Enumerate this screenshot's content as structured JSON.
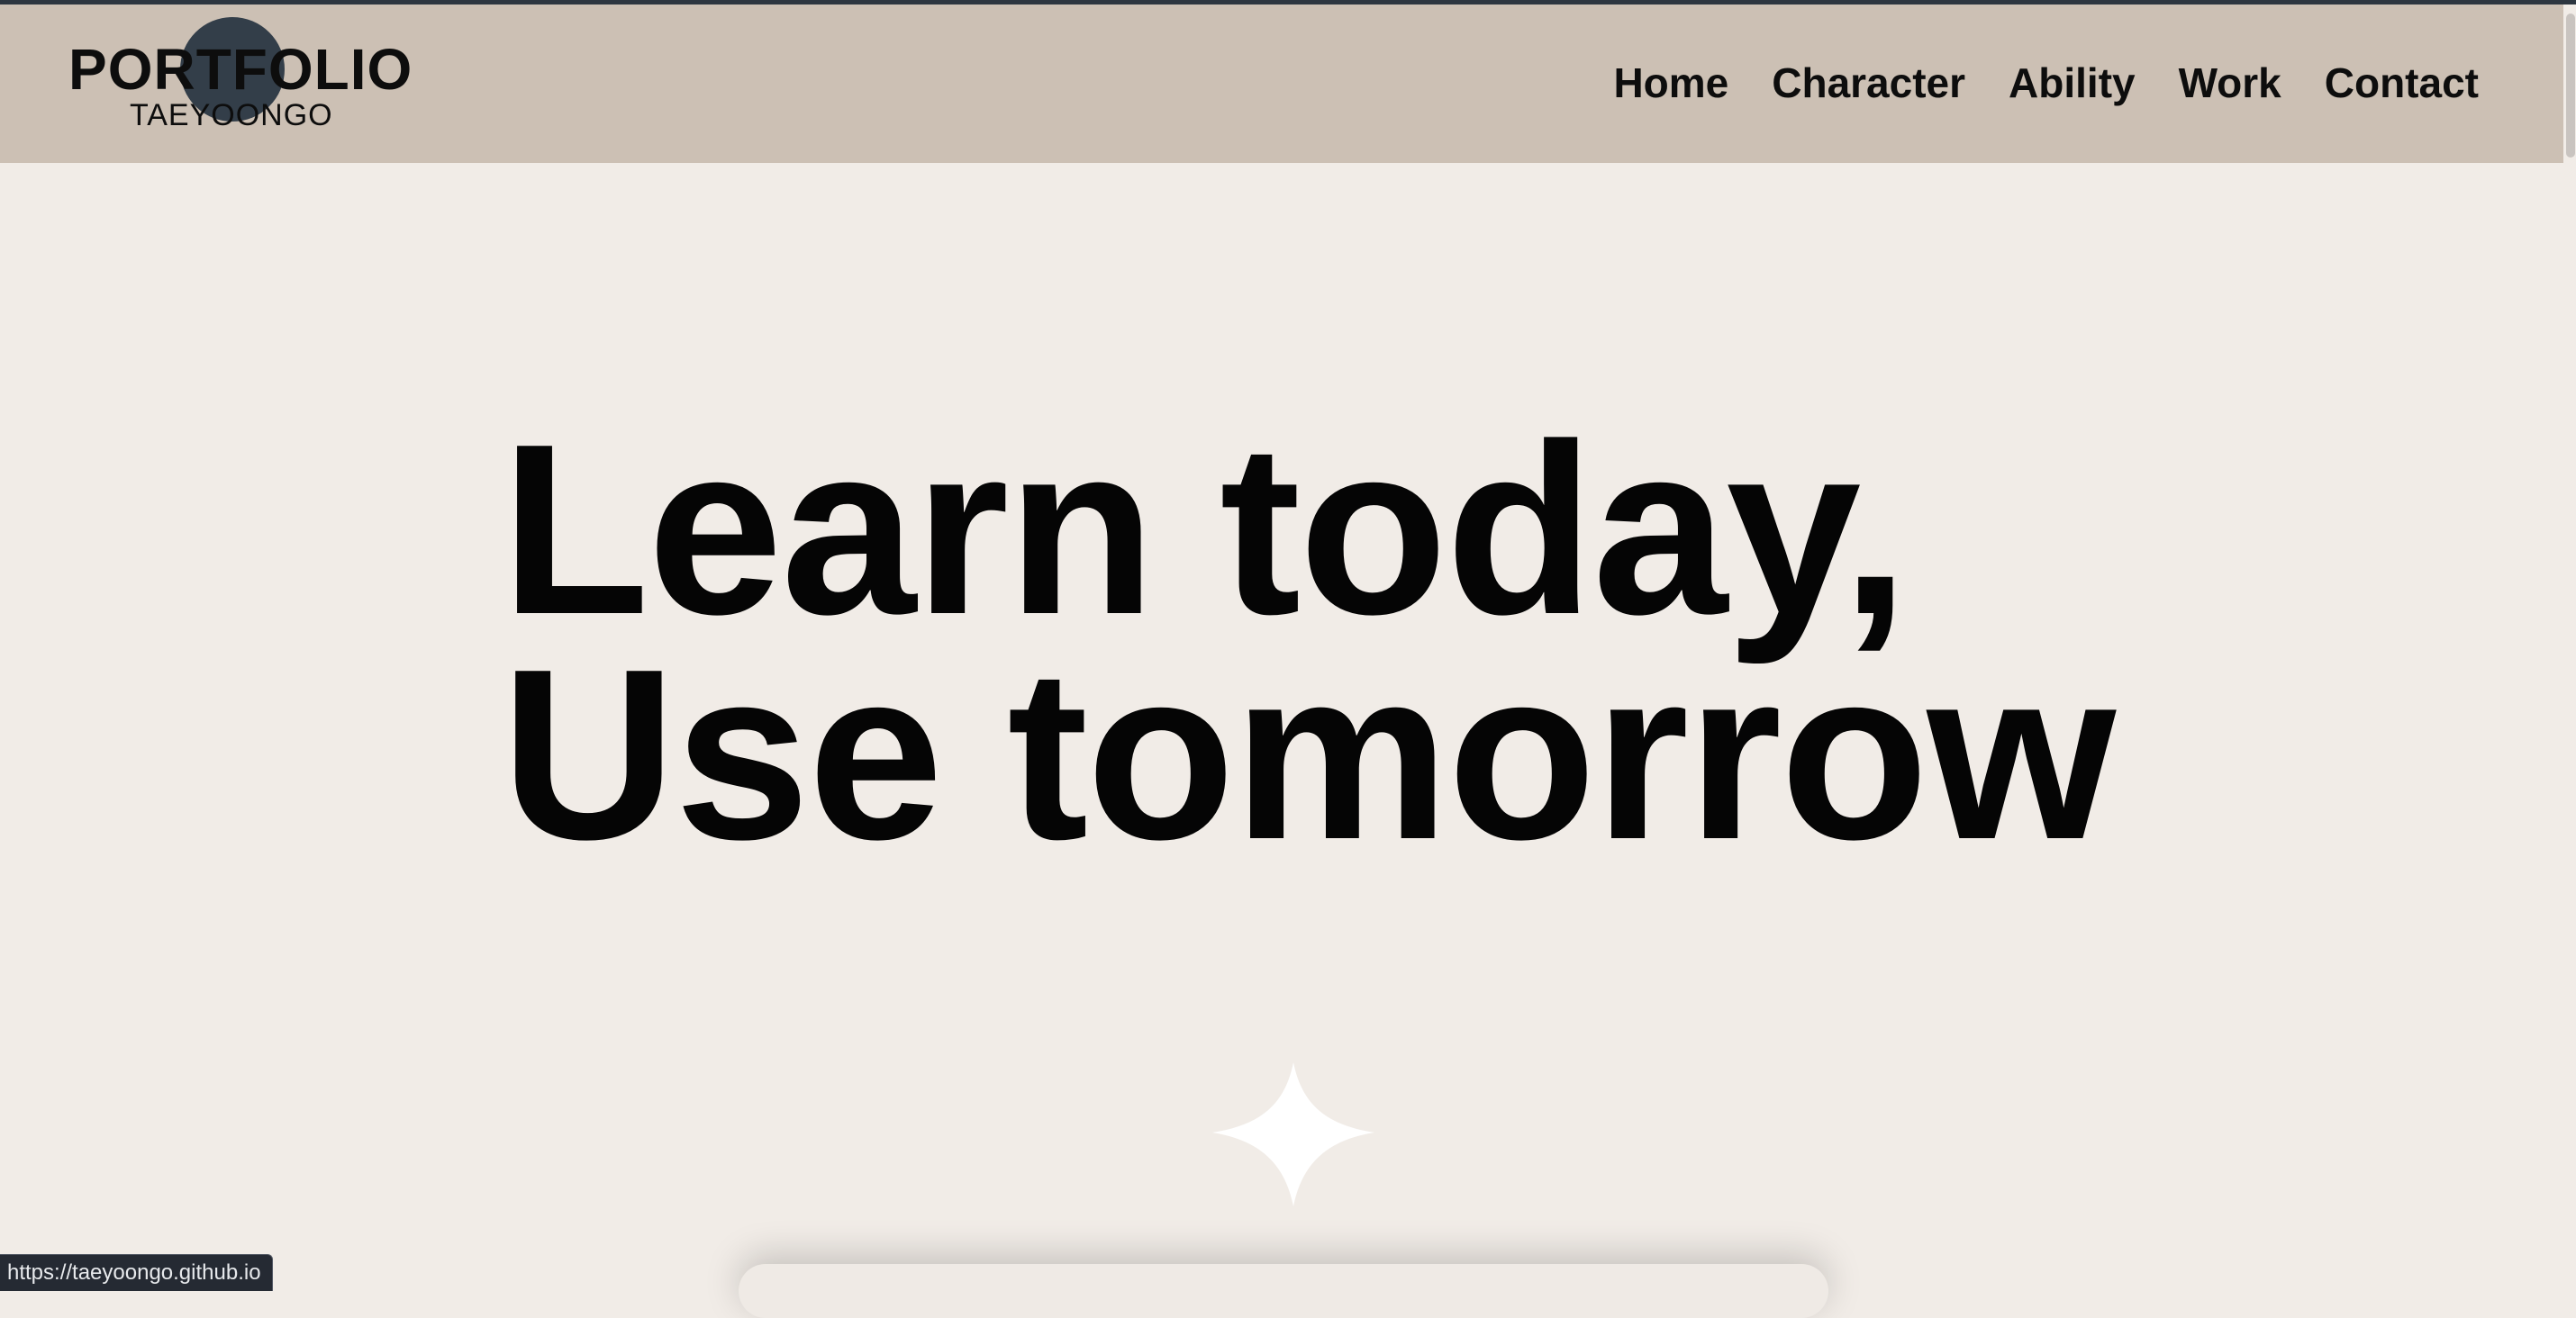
{
  "header": {
    "logo_title": "PORTFOLIO",
    "logo_subtitle": "TAEYOONGO",
    "nav": {
      "home": "Home",
      "character": "Character",
      "ability": "Ability",
      "work": "Work",
      "contact": "Contact"
    }
  },
  "hero": {
    "line1": "Learn today,",
    "line2": "Use tomorrow"
  },
  "decor": {
    "sparkle_icon": "sparkle-icon"
  },
  "status_bar": {
    "url": "https://taeyoongo.github.io"
  },
  "colors": {
    "header_bg": "#ccc0b4",
    "page_bg": "#f1ece7",
    "logo_circle": "#333e49",
    "text": "#0d0d0d"
  }
}
